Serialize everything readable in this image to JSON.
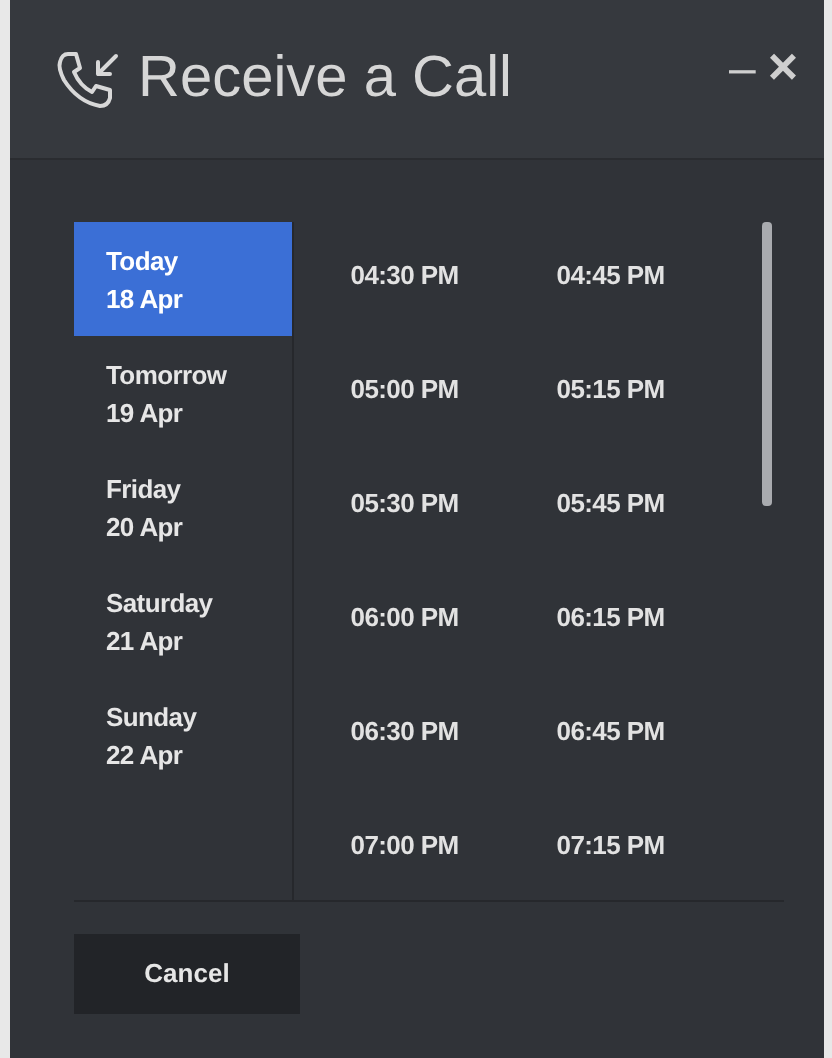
{
  "window": {
    "title": "Receive a Call",
    "controls": [
      "–",
      "×"
    ]
  },
  "days": [
    {
      "day": "Today",
      "date": "18 Apr",
      "selected": true
    },
    {
      "day": "Tomorrow",
      "date": "19 Apr",
      "selected": false
    },
    {
      "day": "Friday",
      "date": "20 Apr",
      "selected": false
    },
    {
      "day": "Saturday",
      "date": "21 Apr",
      "selected": false
    },
    {
      "day": "Sunday",
      "date": "22 Apr",
      "selected": false
    }
  ],
  "times": [
    "04:30 PM",
    "04:45 PM",
    "05:00 PM",
    "05:15 PM",
    "05:30 PM",
    "05:45 PM",
    "06:00 PM",
    "06:15 PM",
    "06:30 PM",
    "06:45 PM",
    "07:00 PM",
    "07:15 PM"
  ],
  "buttons": [
    "Cancel"
  ]
}
